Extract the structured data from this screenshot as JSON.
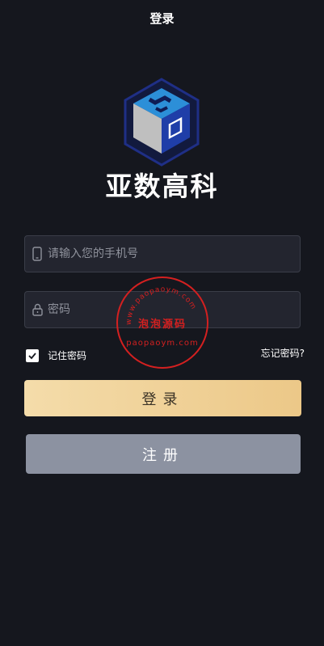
{
  "header": {
    "title": "登录"
  },
  "brand": {
    "name": "亚数高科"
  },
  "form": {
    "phone_placeholder": "请输入您的手机号",
    "password_placeholder": "密码",
    "remember_label": "记住密码",
    "remember_checked": true,
    "forgot_label": "忘记密码?"
  },
  "buttons": {
    "login_label": "登录",
    "register_label": "注册"
  },
  "watermark": {
    "top_text": "www.paopaoym.com",
    "middle_text": "泡泡源码",
    "bottom_text": "paopaoym.com"
  },
  "colors": {
    "background": "#15171e",
    "input_bg": "#23252f",
    "login_gradient_start": "#f4dcaa",
    "login_gradient_end": "#ecc888",
    "register_bg": "#8c92a1",
    "watermark_red": "#d42020"
  },
  "icons": [
    "phone-icon",
    "lock-icon",
    "check-icon"
  ]
}
